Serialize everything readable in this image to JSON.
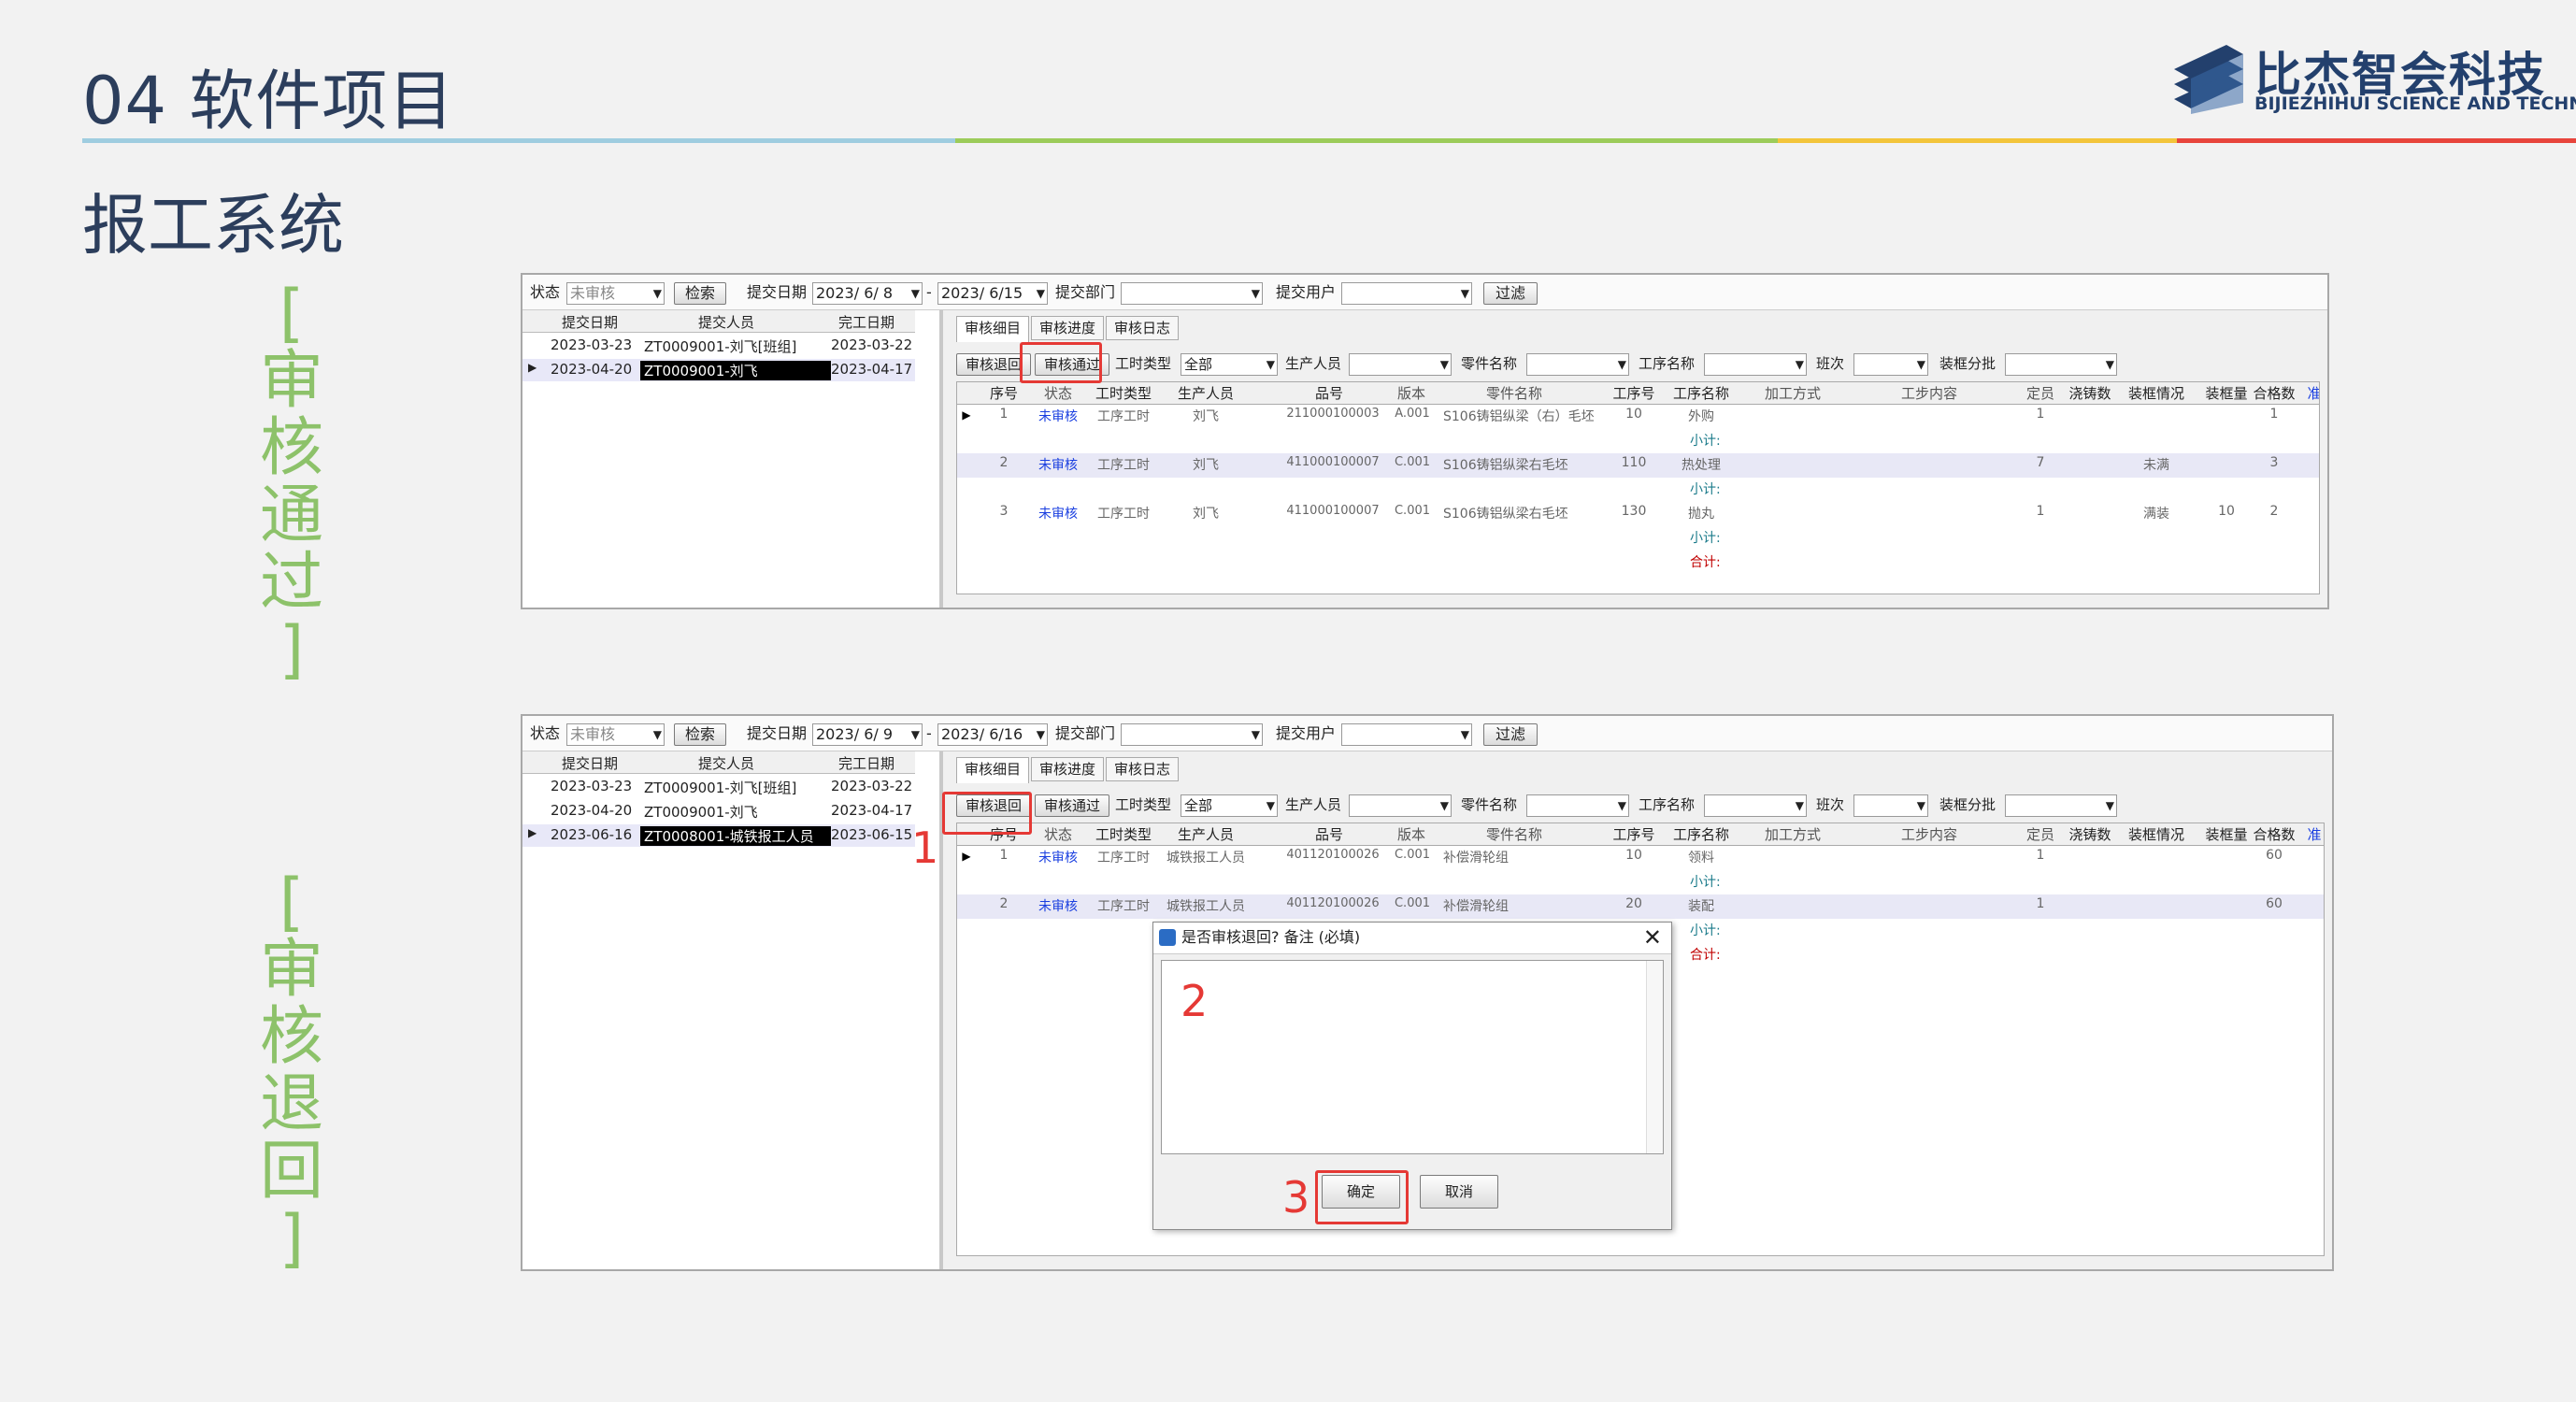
{
  "header": {
    "section": "04  软件项目",
    "subtitle": "报工系统"
  },
  "logo": {
    "cn": "比杰智会科技",
    "en": "BIJIEZHIHUI SCIENCE AND TECHNOLOGY"
  },
  "labels": {
    "pass": "[\n审\n核\n通\n过\n]",
    "return": "[\n审\n核\n退\n回\n]"
  },
  "colors": {
    "accent_green": "#8dc26a",
    "title_blue": "#2c3e5c",
    "highlight_red": "#e53935",
    "unreviewed_blue": "#1a3fe0"
  },
  "window1": {
    "toolbar": {
      "status_label": "状态",
      "status_value": "未审核",
      "search": "检索",
      "date_label": "提交日期",
      "date_from": "2023/ 6/ 8",
      "dash": "-",
      "date_to": "2023/ 6/15",
      "dept_label": "提交部门",
      "user_label": "提交用户",
      "filter": "过滤"
    },
    "left_headers": [
      "提交日期",
      "提交人员",
      "完工日期"
    ],
    "left_rows": [
      {
        "date": "2023-03-23",
        "person": "ZT0009001-刘飞[班组]",
        "done": "2023-03-22"
      },
      {
        "date": "2023-04-20",
        "person": "ZT0009001-刘飞",
        "done": "2023-04-17"
      }
    ],
    "tabs": [
      "审核细目",
      "审核进度",
      "审核日志"
    ],
    "actions": {
      "return": "审核退回",
      "pass": "审核通过",
      "type_label": "工时类型",
      "type_value": "全部",
      "worker_label": "生产人员",
      "part_label": "零件名称",
      "proc_label": "工序名称",
      "shift_label": "班次",
      "box_label": "装框分批"
    },
    "grid_headers": [
      "序号",
      "状态",
      "工时类型",
      "生产人员",
      "品号",
      "版本",
      "零件名称",
      "工序号",
      "工序名称",
      "加工方式",
      "工步内容",
      "定员",
      "浇铸数",
      "装框情况",
      "装框量",
      "合格数",
      "准"
    ],
    "rows": [
      {
        "no": "1",
        "status": "未审核",
        "type": "工序工时",
        "worker": "刘飞",
        "code": "211000100003",
        "ver": "A.001",
        "part": "S106铸铝纵梁（右）毛坯",
        "seq": "10",
        "proc": "外购",
        "staff": "1",
        "box": "",
        "qty": "",
        "ok": "1"
      },
      {
        "no": "2",
        "status": "未审核",
        "type": "工序工时",
        "worker": "刘飞",
        "code": "411000100007",
        "ver": "C.001",
        "part": "S106铸铝纵梁右毛坯",
        "seq": "110",
        "proc": "热处理",
        "staff": "7",
        "box": "未满",
        "qty": "",
        "ok": "3"
      },
      {
        "no": "3",
        "status": "未审核",
        "type": "工序工时",
        "worker": "刘飞",
        "code": "411000100007",
        "ver": "C.001",
        "part": "S106铸铝纵梁右毛坯",
        "seq": "130",
        "proc": "抛丸",
        "staff": "1",
        "box": "满装",
        "qty": "10",
        "ok": "2"
      }
    ],
    "subtotal": "小计:",
    "total": "合计:"
  },
  "window2": {
    "toolbar": {
      "status_label": "状态",
      "status_value": "未审核",
      "search": "检索",
      "date_label": "提交日期",
      "date_from": "2023/ 6/ 9",
      "dash": "-",
      "date_to": "2023/ 6/16",
      "dept_label": "提交部门",
      "user_label": "提交用户",
      "filter": "过滤"
    },
    "left_headers": [
      "提交日期",
      "提交人员",
      "完工日期"
    ],
    "left_rows": [
      {
        "date": "2023-03-23",
        "person": "ZT0009001-刘飞[班组]",
        "done": "2023-03-22"
      },
      {
        "date": "2023-04-20",
        "person": "ZT0009001-刘飞",
        "done": "2023-04-17"
      },
      {
        "date": "2023-06-16",
        "person": "ZT0008001-城铁报工人员",
        "done": "2023-06-15"
      }
    ],
    "tabs": [
      "审核细目",
      "审核进度",
      "审核日志"
    ],
    "actions": {
      "return": "审核退回",
      "pass": "审核通过",
      "type_label": "工时类型",
      "type_value": "全部",
      "worker_label": "生产人员",
      "part_label": "零件名称",
      "proc_label": "工序名称",
      "shift_label": "班次",
      "box_label": "装框分批"
    },
    "grid_headers": [
      "序号",
      "状态",
      "工时类型",
      "生产人员",
      "品号",
      "版本",
      "零件名称",
      "工序号",
      "工序名称",
      "加工方式",
      "工步内容",
      "定员",
      "浇铸数",
      "装框情况",
      "装框量",
      "合格数",
      "准"
    ],
    "rows": [
      {
        "no": "1",
        "status": "未审核",
        "type": "工序工时",
        "worker": "城铁报工人员",
        "code": "401120100026",
        "ver": "C.001",
        "part": "补偿滑轮组",
        "seq": "10",
        "proc": "领料",
        "staff": "1",
        "ok": "60"
      },
      {
        "no": "2",
        "status": "未审核",
        "type": "工序工时",
        "worker": "城铁报工人员",
        "code": "401120100026",
        "ver": "C.001",
        "part": "补偿滑轮组",
        "seq": "20",
        "proc": "装配",
        "staff": "1",
        "ok": "60"
      }
    ],
    "subtotal": "小计:",
    "total": "合计:"
  },
  "dialog": {
    "title": "是否审核退回? 备注 (必填)",
    "close": "✕",
    "ok": "确定",
    "cancel": "取消"
  },
  "steps": [
    "1",
    "2",
    "3"
  ]
}
